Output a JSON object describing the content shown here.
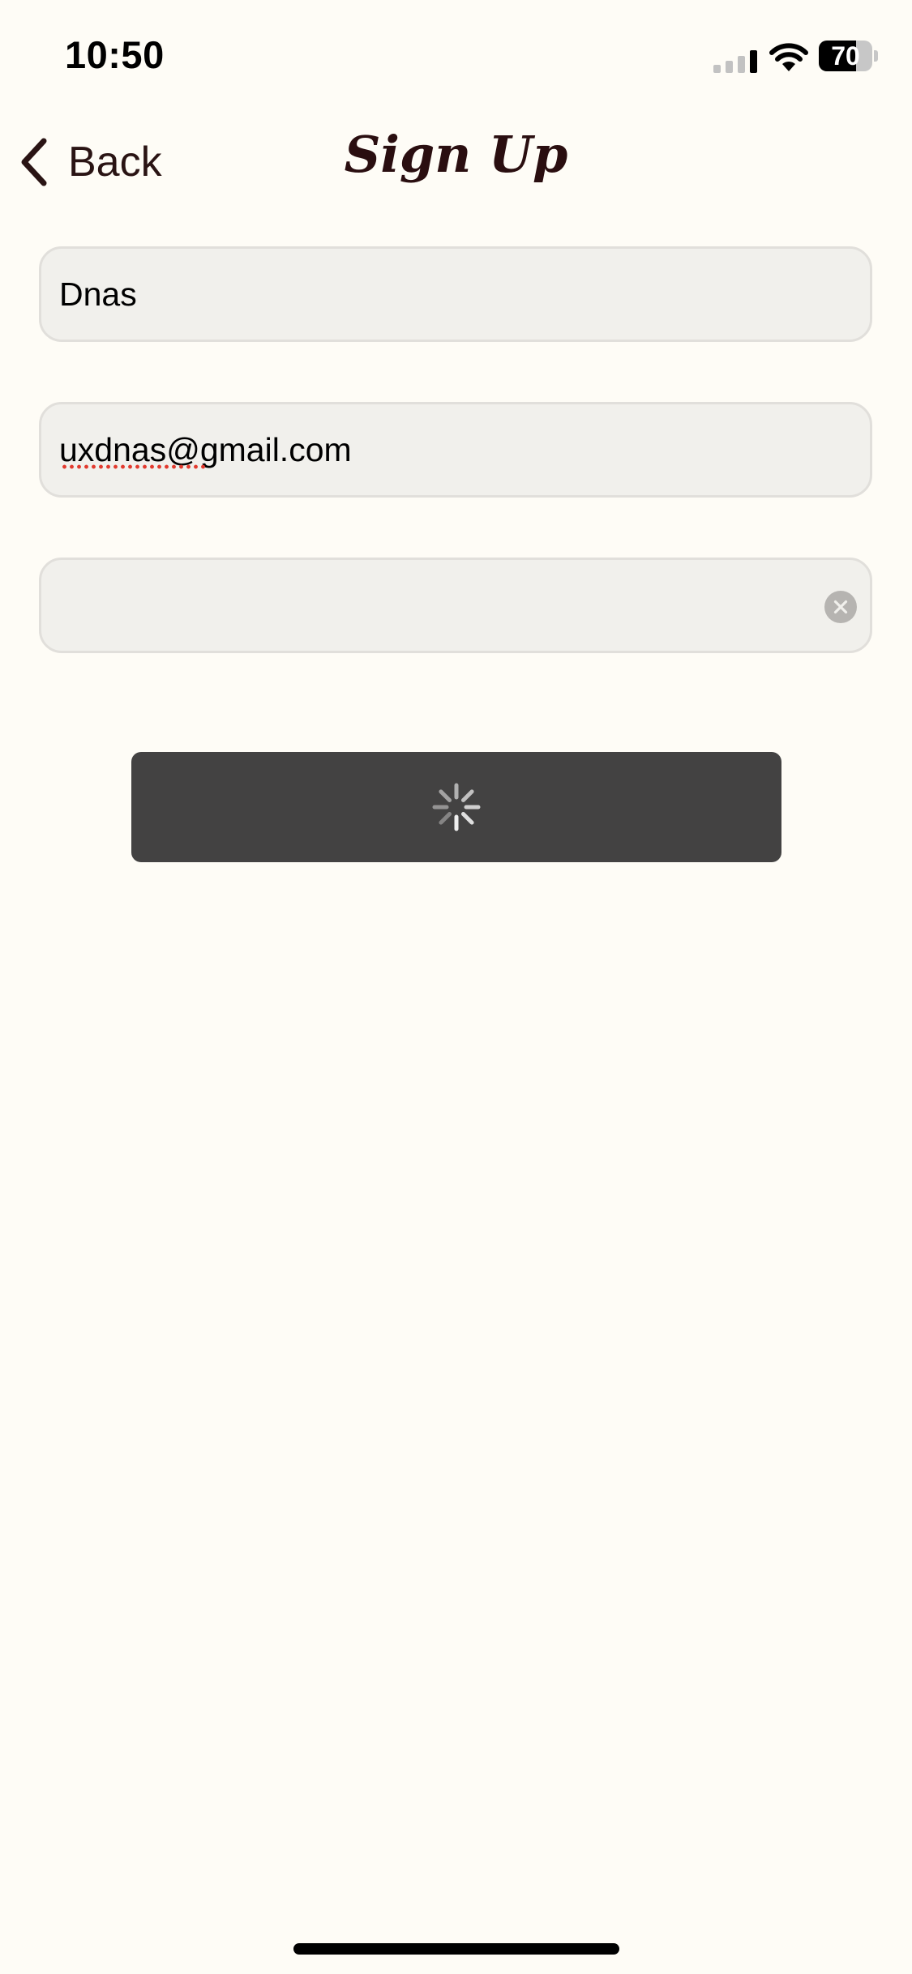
{
  "status_bar": {
    "time": "10:50",
    "battery_level": "70",
    "battery_fraction": 0.7,
    "icons": [
      "signal-icon",
      "wifi-icon",
      "battery-icon"
    ]
  },
  "nav": {
    "back_label": "Back",
    "back_icon": "chevron-left-icon",
    "title": "Sign Up"
  },
  "form": {
    "name_value": "Dnas",
    "email_value": "uxdnas@gmail.com",
    "password_value": "",
    "clear_icon": "clear-icon"
  },
  "submit": {
    "state": "loading",
    "icon": "loading-spinner-icon"
  },
  "colors": {
    "background": "#FEFCF6",
    "field_background": "#F1F0EC",
    "field_border": "#E1DFDB",
    "button_background": "#434242",
    "title_color": "#2A0E10"
  }
}
